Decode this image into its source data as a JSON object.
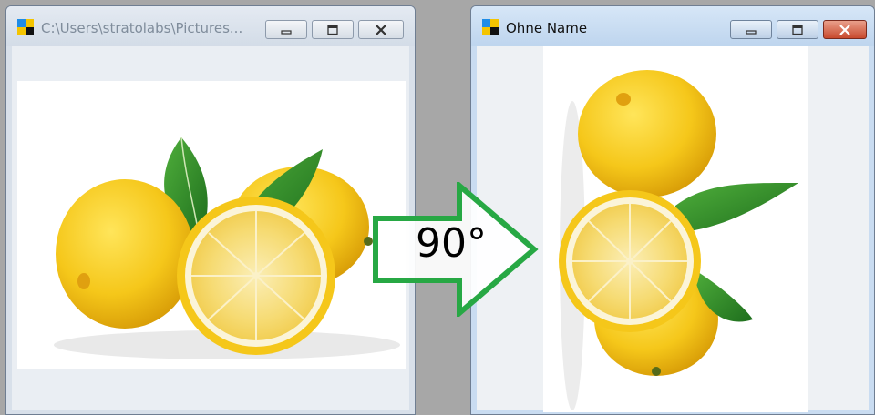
{
  "left_window": {
    "title": "C:\\Users\\stratolabs\\Pictures...",
    "icon": "app-icon",
    "controls": [
      "minimize-icon",
      "maximize-icon",
      "close-icon"
    ]
  },
  "right_window": {
    "title": "Ohne Name",
    "icon": "app-icon",
    "controls": [
      "minimize-icon",
      "maximize-icon",
      "close-icon"
    ]
  },
  "arrow": {
    "label": "90°",
    "color": "#27a844"
  },
  "colors": {
    "lemon": "#f3c51d",
    "leaf": "#2f8a2b",
    "pulp": "#f7dd77"
  }
}
